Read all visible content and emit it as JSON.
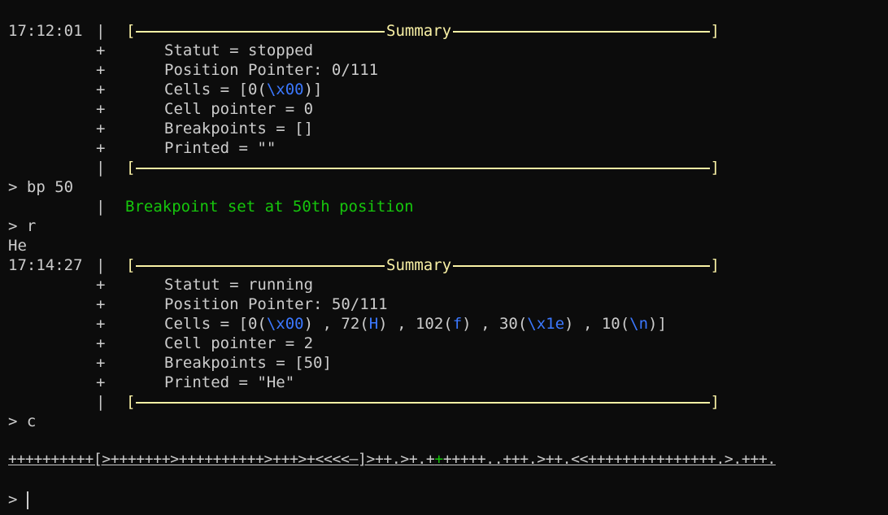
{
  "first_summary": {
    "timestamp": "17:12:01",
    "pipe": "|",
    "title": "Summary",
    "rows": [
      {
        "gutter": "+",
        "text": "Statut = stopped"
      },
      {
        "gutter": "+",
        "text": "Position Pointer: 0/111"
      },
      {
        "gutter": "+",
        "text_prefix": "Cells = [0(",
        "esc": "\\x00",
        "text_suffix": ")]"
      },
      {
        "gutter": "+",
        "text": "Cell pointer = 0"
      },
      {
        "gutter": "+",
        "text": "Breakpoints = []"
      },
      {
        "gutter": "+",
        "text": "Printed = \"\""
      }
    ],
    "closing_pipe": "|"
  },
  "command_bp": {
    "prompt": "> bp 50",
    "pipe": "|",
    "message": "Breakpoint set at 50th position"
  },
  "command_r": {
    "prompt": "> r",
    "output": "He"
  },
  "second_summary": {
    "timestamp": "17:14:27",
    "pipe": "|",
    "title": "Summary",
    "rows": [
      {
        "gutter": "+",
        "text": "Statut = running"
      },
      {
        "gutter": "+",
        "text": "Position Pointer: 50/111"
      },
      {
        "gutter": "+",
        "text": "Cell pointer = 2"
      },
      {
        "gutter": "+",
        "text": "Breakpoints = [50]"
      },
      {
        "gutter": "+",
        "text": "Printed = \"He\""
      }
    ],
    "cells": {
      "prefix": "Cells = [",
      "items": [
        {
          "num": "0(",
          "esc": "\\x00",
          "close": ")"
        },
        {
          "sep": " , ",
          "num": "72(",
          "esc": "H",
          "close": ")"
        },
        {
          "sep": " , ",
          "num": "102(",
          "esc": "f",
          "close": ")"
        },
        {
          "sep": " , ",
          "num": "30(",
          "esc": "\\x1e",
          "close": ")"
        },
        {
          "sep": " , ",
          "num": "10(",
          "esc": "\\n",
          "close": ")"
        }
      ],
      "suffix": "]"
    },
    "closing_pipe": "|"
  },
  "command_c": {
    "prompt": "> c"
  },
  "tape": {
    "before": "++++++++++[>+++++++>++++++++++>+++>+<<<<—]>++.>+.+",
    "current": "+",
    "after": "+++++..+++.>++.<<+++++++++++++++.>.+++."
  },
  "input_prompt": {
    "prompt": "> "
  },
  "colors": {
    "background": "#0c0c0c",
    "foreground": "#cccccc",
    "box": "#f9f1a5",
    "escape": "#3b78ff",
    "success": "#16c60c"
  }
}
